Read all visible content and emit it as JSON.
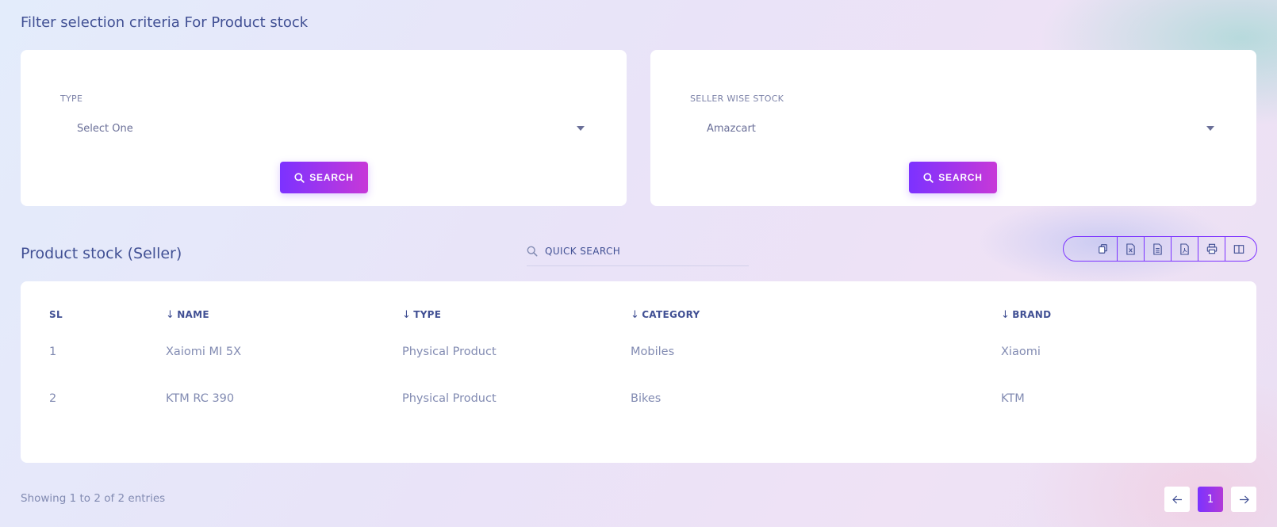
{
  "page_title": "Filter selection criteria For Product stock",
  "filters": {
    "type": {
      "label": "TYPE",
      "selected": "Select One",
      "button": "SEARCH"
    },
    "seller": {
      "label": "SELLER WISE STOCK",
      "selected": "Amazcart",
      "button": "SEARCH"
    }
  },
  "section_title": "Product stock (Seller)",
  "quick_search": {
    "placeholder": "QUICK SEARCH"
  },
  "toolbar": {
    "buttons": [
      "copy-icon",
      "excel-icon",
      "csv-icon",
      "pdf-icon",
      "print-icon",
      "columns-icon"
    ]
  },
  "table": {
    "headers": {
      "sl": "SL",
      "name": "NAME",
      "type": "TYPE",
      "category": "CATEGORY",
      "brand": "BRAND"
    },
    "rows": [
      {
        "sl": "1",
        "name": "Xaiomi MI 5X",
        "type": "Physical Product",
        "category": "Mobiles",
        "brand": "Xiaomi"
      },
      {
        "sl": "2",
        "name": "KTM RC 390",
        "type": "Physical Product",
        "category": "Bikes",
        "brand": "KTM"
      }
    ]
  },
  "footer": {
    "entries_text": "Showing 1 to 2 of 2 entries",
    "current_page": "1"
  },
  "colors": {
    "accent": "#7c32ff",
    "accent_end": "#c738d8",
    "text": "#415094",
    "muted": "#828bb2"
  }
}
